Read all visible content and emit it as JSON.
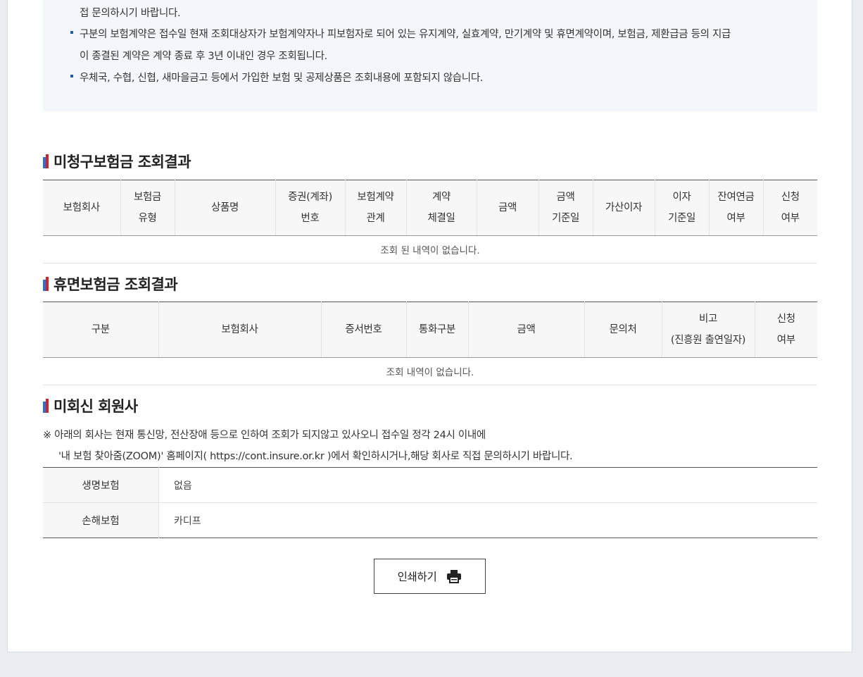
{
  "notice": {
    "lines": [
      "접 문의하시기 바랍니다.",
      "구분의 보험계약은 접수일 현재 조회대상자가 보험계약자나 피보험자로 되어 있는 유지계약, 실효계약, 만기계약 및 휴면계약이며, 보험금, 제환급금 등의 지급",
      "이 종결된 계약은 계약 종료 후 3년 이내인 경우 조회됩니다.",
      "우체국, 수협, 신협, 새마을금고 등에서 가입한 보험 및 공제상품은 조회내용에 포함되지 않습니다."
    ]
  },
  "unclaimed": {
    "title": "미청구보험금 조회결과",
    "headers": [
      [
        "보험회사"
      ],
      [
        "보험금",
        "유형"
      ],
      [
        "상품명"
      ],
      [
        "증권(계좌)",
        "번호"
      ],
      [
        "보험계약",
        "관계"
      ],
      [
        "계약",
        "체결일"
      ],
      [
        "금액"
      ],
      [
        "금액",
        "기준일"
      ],
      [
        "가산이자"
      ],
      [
        "이자",
        "기준일"
      ],
      [
        "잔여연금",
        "여부"
      ],
      [
        "신청",
        "여부"
      ]
    ],
    "empty_text": "조회 된 내역이 없습니다."
  },
  "dormant": {
    "title": "휴면보험금 조회결과",
    "headers": [
      [
        "구분"
      ],
      [
        "보험회사"
      ],
      [
        "증서번호"
      ],
      [
        "통화구분"
      ],
      [
        "금액"
      ],
      [
        "문의처"
      ],
      [
        "비고",
        "(진흥원 출연일자)"
      ],
      [
        "신청",
        "여부"
      ]
    ],
    "empty_text": "조회 내역이 없습니다."
  },
  "nonresponse": {
    "title": "미회신 회원사",
    "desc_line1": "※ 아래의 회사는 현재 통신망, 전산장애 등으로 인하여 조회가 되지않고 있사오니 접수일 정각 24시 이내에",
    "desc_line2": "'내 보험 찾아줌(ZOOM)' 홈페이지( https://cont.insure.or.kr )에서 확인하시거나,해당 회사로 직접 문의하시기 바랍니다.",
    "rows": [
      {
        "label": "생명보험",
        "value": "없음"
      },
      {
        "label": "손해보험",
        "value": "카디프"
      }
    ]
  },
  "print_button": {
    "label": "인쇄하기",
    "icon": "printer-icon"
  }
}
